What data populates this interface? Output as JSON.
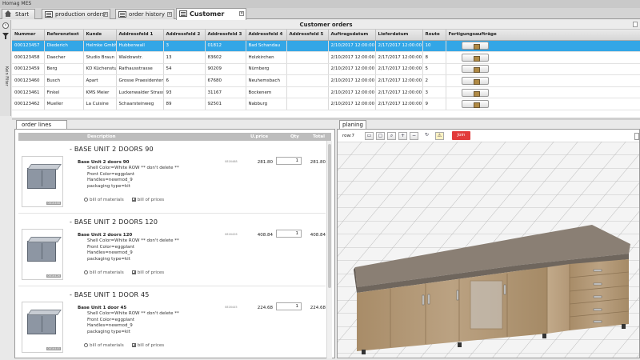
{
  "window": {
    "title": "Homag MES"
  },
  "tabs": [
    {
      "label": "Start"
    },
    {
      "label": "production orders"
    },
    {
      "label": "order history"
    },
    {
      "label": "Customer orders",
      "active": true
    }
  ],
  "sidebar": {
    "circle_symbol": "›",
    "filter_label": "Kein Filter"
  },
  "orders": {
    "title": "Customer orders",
    "columns": [
      "Nummer",
      "Referenztext",
      "Kunde",
      "Addressfeld 1",
      "Addressfeld 2",
      "Addressfeld 3",
      "Addressfeld 4",
      "Addressfeld 5",
      "Auftragsdatum",
      "Lieferdatum",
      "Route",
      "Fertigungsaufträge"
    ],
    "rows": [
      [
        "000123457",
        "Diederich",
        "Helmke GmbH",
        "Hubbenwall",
        "3",
        "01812",
        "Bad Schandau",
        "",
        "2/10/2017 12:00:00 AM",
        "2/17/2017 12:00:00 AM",
        "10"
      ],
      [
        "000123458",
        "Daecher",
        "Studio Braun",
        "Waldowstr.",
        "13",
        "83602",
        "Holzkirchen",
        "",
        "2/10/2017 12:00:00 AM",
        "2/17/2017 12:00:00 AM",
        "8"
      ],
      [
        "000123459",
        "Berg",
        "KD Küchenstudio",
        "Rathausstrasse",
        "54",
        "90209",
        "Nürnberg",
        "",
        "2/10/2017 12:00:00 AM",
        "2/17/2017 12:00:00 AM",
        "5"
      ],
      [
        "000123460",
        "Busch",
        "Apart",
        "Grosse Praesidenten Str.",
        "6",
        "67680",
        "Neuhemsbach",
        "",
        "2/10/2017 12:00:00 AM",
        "2/17/2017 12:00:00 AM",
        "2"
      ],
      [
        "000123461",
        "Finkel",
        "KMS Meier",
        "Luckenwalder Strasse",
        "93",
        "31167",
        "Bockenem",
        "",
        "2/10/2017 12:00:00 AM",
        "2/17/2017 12:00:00 AM",
        "3"
      ],
      [
        "000123462",
        "Mueller",
        "La Cuisine",
        "Schaarsteinweg",
        "89",
        "92501",
        "Nabburg",
        "",
        "2/10/2017 12:00:00 AM",
        "2/17/2017 12:00:00 AM",
        "9"
      ]
    ],
    "selected_row": 0
  },
  "order_lines": {
    "tab_label": "order lines",
    "headers": {
      "description": "Description",
      "price": "U.price",
      "qty": "Qty",
      "total": "Total"
    },
    "items": [
      {
        "group_title": "- BASE UNIT 2 DOORS 90",
        "name": "Base Unit 2 doors 90",
        "attrs": [
          "Shell Color=White ROW ** don't delete **",
          "Front Color=eggplant",
          "Handles=newmod_9",
          "packaging type=kit"
        ],
        "code": "0816468",
        "img_code": "0816468",
        "price": "281.80",
        "qty": "1",
        "total": "281.80",
        "bom": "bill of materials",
        "prices": "bill of prices"
      },
      {
        "group_title": "- BASE UNIT 2 DOORS 120",
        "name": "Base Unit 2 doors 120",
        "attrs": [
          "Shell Color=White ROW ** don't delete **",
          "Front Color=eggplant",
          "Handles=newmod_9",
          "packaging type=kit"
        ],
        "code": "0816426",
        "img_code": "0816426",
        "price": "408.84",
        "qty": "1",
        "total": "408.84",
        "bom": "bill of materials",
        "prices": "bill of prices"
      },
      {
        "group_title": "- BASE UNIT 1 DOOR 45",
        "name": "Base Unit 1 door 45",
        "attrs": [
          "Shell Color=White ROW ** don't delete **",
          "Front Color=eggplant",
          "Handles=newmod_9",
          "packaging type=kit"
        ],
        "code": "0816445",
        "img_code": "0816445",
        "price": "224.68",
        "qty": "1",
        "total": "224.68",
        "bom": "bill of materials",
        "prices": "bill of prices"
      }
    ]
  },
  "planing": {
    "tab_label": "planing",
    "row_label": "row:7",
    "join_label": "Join",
    "toolbar_icons": [
      "floorplan-icon",
      "monitor-icon",
      "zoom-fit-icon",
      "zoom-in-icon",
      "zoom-out-icon",
      "refresh-icon",
      "warning-icon"
    ]
  },
  "colors": {
    "selection": "#33a6e6",
    "join_button": "#e23b3b",
    "wood": "#b59a76",
    "countertop": "#8a7f74",
    "floor_grid": "#b9b9b9"
  }
}
